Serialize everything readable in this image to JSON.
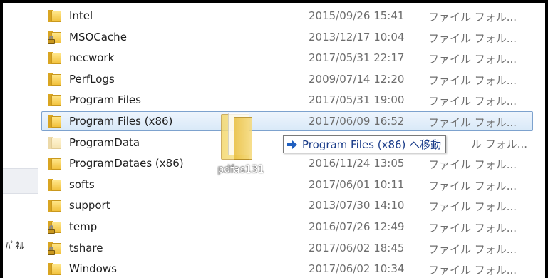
{
  "files": [
    {
      "name": "Intel",
      "date": "2015/09/26 15:41",
      "type": "ファイル フォル...",
      "icon": "folder",
      "locked": false,
      "selected": false,
      "faded": false
    },
    {
      "name": "MSOCache",
      "date": "2013/12/17 10:04",
      "type": "ファイル フォル...",
      "icon": "folder",
      "locked": true,
      "selected": false,
      "faded": false
    },
    {
      "name": "necwork",
      "date": "2017/05/31 22:17",
      "type": "ファイル フォル...",
      "icon": "folder",
      "locked": false,
      "selected": false,
      "faded": false
    },
    {
      "name": "PerfLogs",
      "date": "2009/07/14 12:20",
      "type": "ファイル フォル...",
      "icon": "folder",
      "locked": false,
      "selected": false,
      "faded": false
    },
    {
      "name": "Program Files",
      "date": "2017/05/31 19:00",
      "type": "ファイル フォル...",
      "icon": "folder",
      "locked": false,
      "selected": false,
      "faded": false
    },
    {
      "name": "Program Files (x86)",
      "date": "2017/06/09 16:52",
      "type": "ファイル フォル...",
      "icon": "folder",
      "locked": false,
      "selected": true,
      "faded": false
    },
    {
      "name": "ProgramData",
      "date": "",
      "type": "ル フォル...",
      "icon": "folder",
      "locked": false,
      "selected": false,
      "faded": true
    },
    {
      "name": "ProgramDataes (x86)",
      "date": "2016/11/24 13:05",
      "type": "ファイル フォル...",
      "icon": "folder",
      "locked": false,
      "selected": false,
      "faded": false
    },
    {
      "name": "softs",
      "date": "2017/06/01 10:11",
      "type": "ファイル フォル...",
      "icon": "folder",
      "locked": false,
      "selected": false,
      "faded": false
    },
    {
      "name": "support",
      "date": "2013/07/30 14:10",
      "type": "ファイル フォル...",
      "icon": "folder",
      "locked": false,
      "selected": false,
      "faded": false
    },
    {
      "name": "temp",
      "date": "2016/07/26 12:49",
      "type": "ファイル フォル...",
      "icon": "folder",
      "locked": true,
      "selected": false,
      "faded": false
    },
    {
      "name": "tshare",
      "date": "2017/06/02 18:45",
      "type": "ファイル フォル...",
      "icon": "folder",
      "locked": true,
      "selected": false,
      "faded": false
    },
    {
      "name": "Windows",
      "date": "2017/06/02 10:34",
      "type": "ファイル フォル...",
      "icon": "folder",
      "locked": false,
      "selected": false,
      "faded": false
    }
  ],
  "nav_pane": {
    "partial_label": "ﾊﾟﾈﾙ"
  },
  "drag": {
    "ghost_label": "pdfas131",
    "drop_tooltip": "Program Files (x86) へ移動",
    "drop_icon": "arrow-right-icon"
  },
  "colors": {
    "selection_border": "#7da2ce",
    "selection_fill": "#e5f0fb",
    "folder_yellow": "#f2c13c",
    "tooltip_text": "#1b3d8a",
    "date_text": "#6d6d6d"
  }
}
